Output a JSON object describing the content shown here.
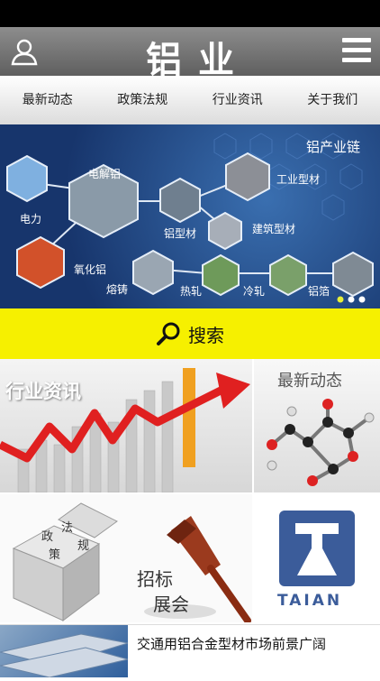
{
  "header": {
    "title": "铝业"
  },
  "nav": [
    {
      "label": "最新动态"
    },
    {
      "label": "政策法规"
    },
    {
      "label": "行业资讯"
    },
    {
      "label": "关于我们"
    }
  ],
  "banner": {
    "title": "铝产业链",
    "nodes": [
      "电解铝",
      "电力",
      "氧化铝",
      "铝型材",
      "工业型材",
      "建筑型材",
      "熔铸",
      "热轧",
      "冷轧",
      "铝箔"
    ]
  },
  "search": {
    "label": "搜索"
  },
  "tiles": {
    "industry_news": "行业资讯",
    "latest_news": "最新动态",
    "policy_cube": [
      "政",
      "法",
      "策",
      "规"
    ],
    "tender_line1": "招标",
    "tender_line2": "展会",
    "brand": "TAIAN"
  },
  "news": {
    "headline": "交通用铝合金型材市场前景广阔"
  },
  "colors": {
    "accent_yellow": "#f6f000",
    "header_gray": "#777777",
    "chart_red": "#e02020"
  }
}
